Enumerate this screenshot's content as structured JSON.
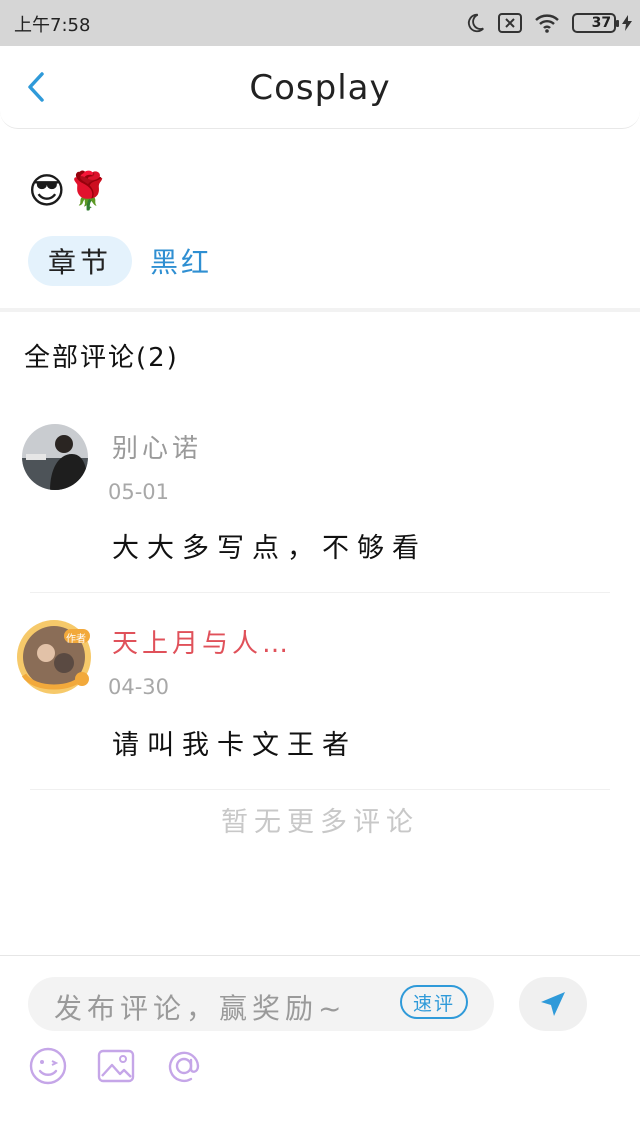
{
  "status_bar": {
    "time": "上午7:58",
    "battery": "37"
  },
  "header": {
    "title": "Cosplay"
  },
  "post": {
    "emojis": "😎🌹",
    "chapter_tag": "章节",
    "chapter_name": "黑红"
  },
  "comments": {
    "title": "全部评论(2)",
    "items": [
      {
        "name": "别心诺",
        "date": "05-01",
        "text": "大大多写点，不够看"
      },
      {
        "name": "天上月与人…",
        "date": "04-30",
        "text": "请叫我卡文王者",
        "badge": "作者"
      }
    ],
    "no_more": "暂无更多评论"
  },
  "composer": {
    "placeholder": "发布评论，赢奖励~",
    "quick_label": "速评"
  },
  "colors": {
    "accent": "#2f9ad9",
    "author_name": "#e0515a",
    "icon_purple": "#c5a6e8"
  },
  "icons": [
    "moon-icon",
    "sim-off-icon",
    "wifi-icon",
    "battery-icon",
    "back-chevron-icon",
    "send-icon",
    "emoji-icon",
    "image-icon",
    "at-icon"
  ]
}
